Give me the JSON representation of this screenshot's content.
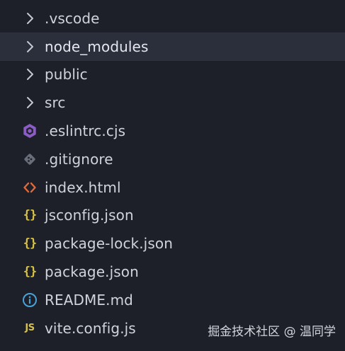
{
  "explorer": {
    "items": [
      {
        "label": ".vscode",
        "kind": "folder",
        "icon": "chevron-right-icon",
        "selected": false
      },
      {
        "label": "node_modules",
        "kind": "folder",
        "icon": "chevron-right-icon",
        "selected": true
      },
      {
        "label": "public",
        "kind": "folder",
        "icon": "chevron-right-icon",
        "selected": false
      },
      {
        "label": "src",
        "kind": "folder",
        "icon": "chevron-right-icon",
        "selected": false
      },
      {
        "label": ".eslintrc.cjs",
        "kind": "file",
        "icon": "eslint-icon",
        "selected": false
      },
      {
        "label": ".gitignore",
        "kind": "file",
        "icon": "git-icon",
        "selected": false
      },
      {
        "label": "index.html",
        "kind": "file",
        "icon": "html-icon",
        "selected": false
      },
      {
        "label": "jsconfig.json",
        "kind": "file",
        "icon": "json-icon",
        "selected": false
      },
      {
        "label": "package-lock.json",
        "kind": "file",
        "icon": "json-icon",
        "selected": false
      },
      {
        "label": "package.json",
        "kind": "file",
        "icon": "json-icon",
        "selected": false
      },
      {
        "label": "README.md",
        "kind": "file",
        "icon": "info-icon",
        "selected": false
      },
      {
        "label": "vite.config.js",
        "kind": "file",
        "icon": "javascript-icon",
        "selected": false
      }
    ]
  },
  "icon_glyphs": {
    "json_icon": "{}",
    "javascript_icon": "JS"
  },
  "watermark": "掘金技术社区 @ 温同学",
  "colors": {
    "background": "#1e2029",
    "selected_row": "#2b2e3b",
    "text": "#cfd3dc",
    "chevron": "#c5c8d0",
    "eslint": "#8a5cc4",
    "git": "#6a6e79",
    "html": "#e06a3a",
    "json": "#d6c14b",
    "info": "#4aa3d8",
    "javascript": "#d6c14b"
  }
}
